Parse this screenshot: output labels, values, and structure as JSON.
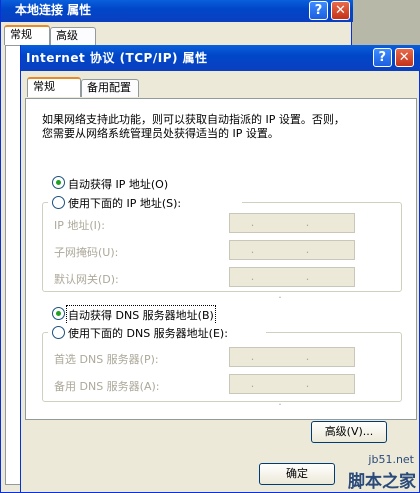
{
  "back_window": {
    "title": "本地连接 属性",
    "tabs": [
      "常规",
      "高级"
    ],
    "help_glyph": "?",
    "close_glyph": "✕"
  },
  "dialog": {
    "title": "Internet 协议 (TCP/IP) 属性",
    "help_glyph": "?",
    "close_glyph": "✕",
    "tabs": [
      "常规",
      "备用配置"
    ],
    "description_line1": "如果网络支持此功能，则可以获取自动指派的 IP 设置。否则，",
    "description_line2": "您需要从网络系统管理员处获得适当的 IP 设置。",
    "ip_auto_label": "自动获得 IP 地址(O)",
    "ip_manual_label": "使用下面的 IP 地址(S):",
    "ip_fields": [
      {
        "label": "IP 地址(I):",
        "value": ". . ."
      },
      {
        "label": "子网掩码(U):",
        "value": ". . ."
      },
      {
        "label": "默认网关(D):",
        "value": ". . ."
      }
    ],
    "dns_auto_label": "自动获得 DNS 服务器地址(B)",
    "dns_manual_label": "使用下面的 DNS 服务器地址(E):",
    "dns_fields": [
      {
        "label": "首选 DNS 服务器(P):",
        "value": ". . ."
      },
      {
        "label": "备用 DNS 服务器(A):",
        "value": ". . ."
      }
    ],
    "advanced_button": "高级(V)...",
    "ok_button": "确定"
  },
  "watermark": {
    "line1": "jb51.net",
    "line2": "脚本之家"
  }
}
